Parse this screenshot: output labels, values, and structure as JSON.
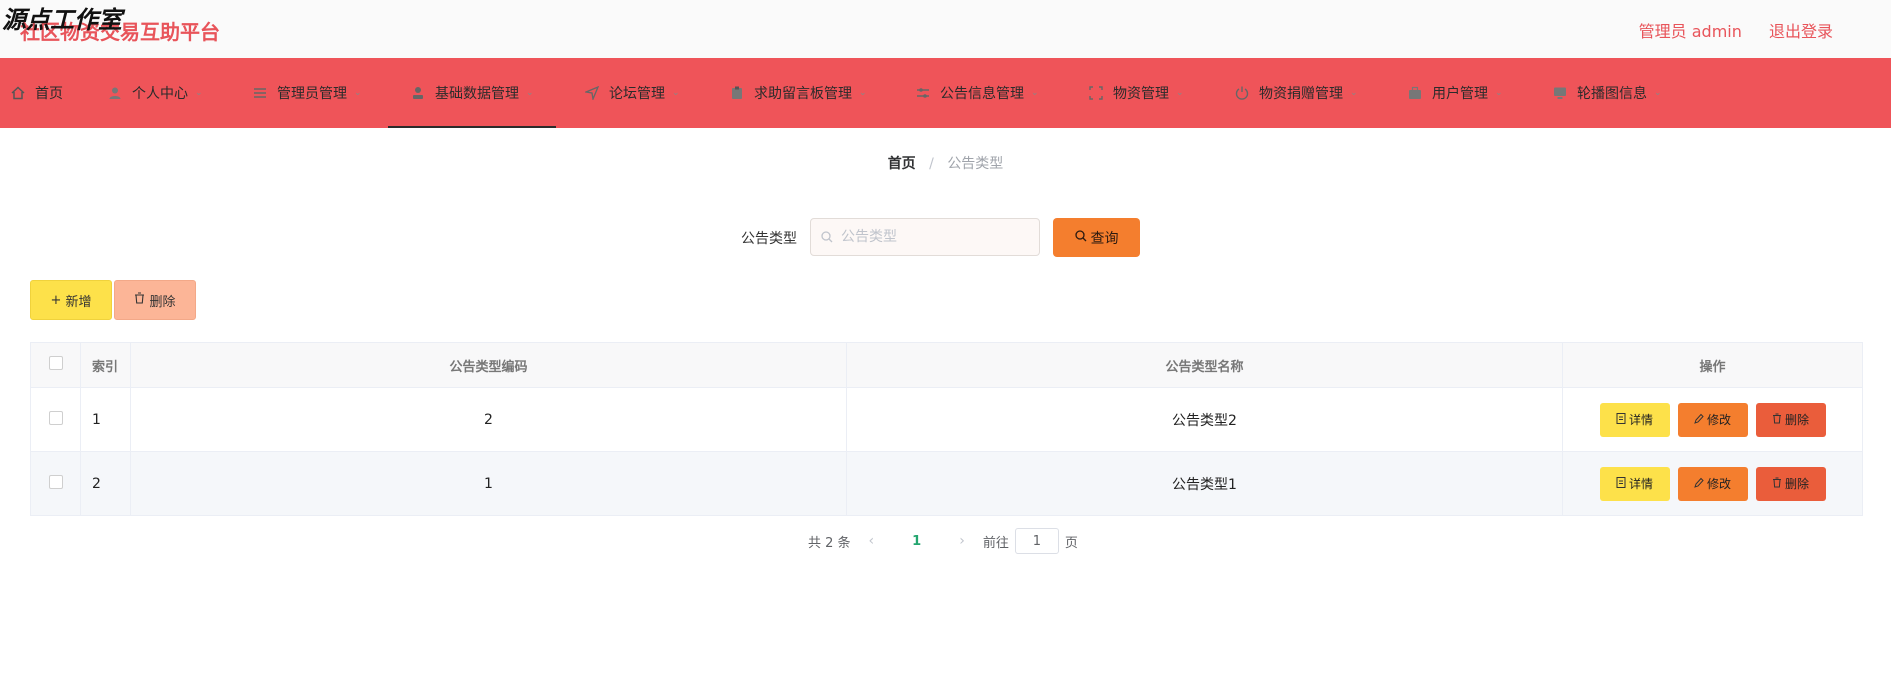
{
  "header": {
    "watermark": "源点工作室",
    "app_title": "社区物资交易互助平台",
    "user_label": "管理员 admin",
    "logout_label": "退出登录"
  },
  "nav": {
    "items": [
      {
        "label": "首页",
        "icon": "home-icon"
      },
      {
        "label": "个人中心",
        "icon": "user-icon"
      },
      {
        "label": "管理员管理",
        "icon": "list-icon"
      },
      {
        "label": "基础数据管理",
        "icon": "person-icon"
      },
      {
        "label": "论坛管理",
        "icon": "send-icon"
      },
      {
        "label": "求助留言板管理",
        "icon": "clipboard-icon"
      },
      {
        "label": "公告信息管理",
        "icon": "sliders-icon"
      },
      {
        "label": "物资管理",
        "icon": "frame-icon"
      },
      {
        "label": "物资捐赠管理",
        "icon": "power-icon"
      },
      {
        "label": "用户管理",
        "icon": "briefcase-icon"
      },
      {
        "label": "轮播图信息",
        "icon": "monitor-icon"
      }
    ],
    "active_index": 3
  },
  "breadcrumb": {
    "home": "首页",
    "separator": "/",
    "current": "公告类型"
  },
  "search": {
    "label": "公告类型",
    "placeholder": "公告类型",
    "value": "",
    "button_label": "查询"
  },
  "toolbar": {
    "add_label": "新增",
    "delete_label": "删除"
  },
  "table": {
    "columns": [
      "索引",
      "公告类型编码",
      "公告类型名称",
      "操作"
    ],
    "rows": [
      {
        "index": "1",
        "code": "2",
        "name": "公告类型2"
      },
      {
        "index": "2",
        "code": "1",
        "name": "公告类型1"
      }
    ],
    "actions": {
      "detail": "详情",
      "edit": "修改",
      "delete": "删除"
    }
  },
  "pagination": {
    "total_text": "共 2 条",
    "current_page": "1",
    "goto_prefix": "前往",
    "goto_value": "1",
    "goto_suffix": "页"
  },
  "colors": {
    "primary": "#ef5459",
    "accent_orange": "#f47e2e",
    "accent_yellow": "#fde14a",
    "danger": "#ea5d3b"
  }
}
